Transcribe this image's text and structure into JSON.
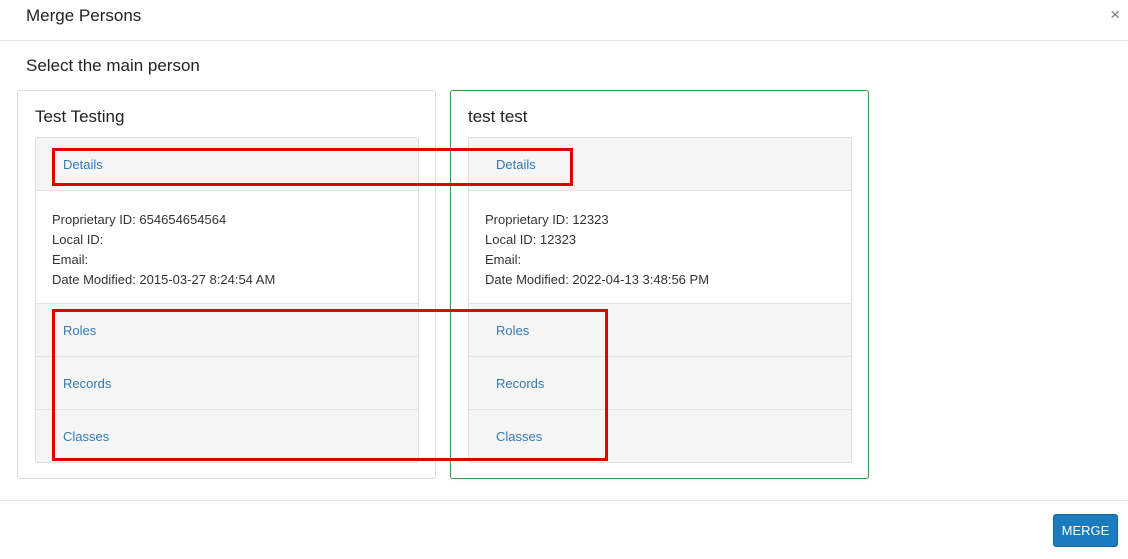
{
  "modal": {
    "title": "Merge Persons",
    "close_glyph": "×",
    "subtitle": "Select the main person",
    "merge_label": "MERGE"
  },
  "persons": [
    {
      "name": "Test Testing",
      "selected": false,
      "sections": {
        "details": "Details",
        "roles": "Roles",
        "records": "Records",
        "classes": "Classes"
      },
      "details": {
        "proprietary_id": "Proprietary ID: 654654654564",
        "local_id": "Local ID:",
        "email": "Email:",
        "date_modified": "Date Modified: 2015-03-27 8:24:54 AM"
      }
    },
    {
      "name": "test test",
      "selected": true,
      "sections": {
        "details": "Details",
        "roles": "Roles",
        "records": "Records",
        "classes": "Classes"
      },
      "details": {
        "proprietary_id": "Proprietary ID: 12323",
        "local_id": "Local ID: 12323",
        "email": "Email:",
        "date_modified": "Date Modified: 2022-04-13 3:48:56 PM"
      }
    }
  ],
  "colors": {
    "link": "#337ab7",
    "selected_border": "#3c9a48",
    "annotation": "#e00000",
    "primary_button": "#1b7bbf"
  }
}
